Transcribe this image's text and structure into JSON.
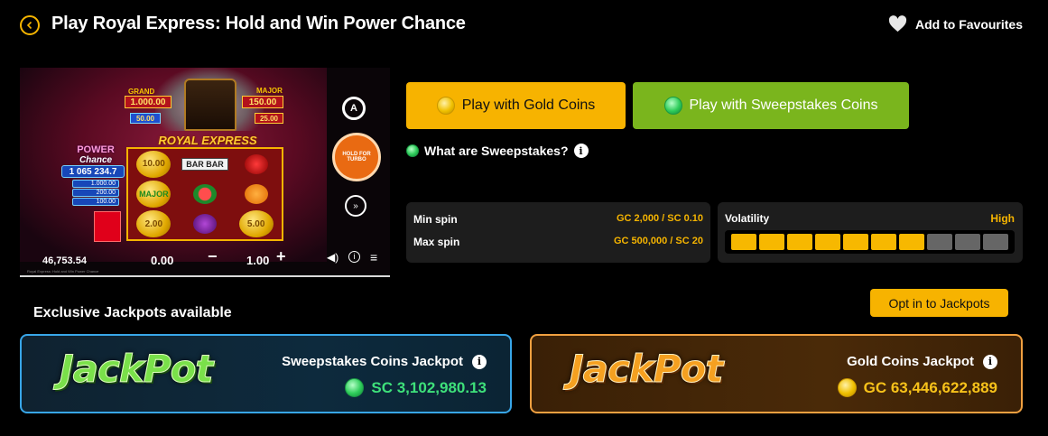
{
  "header": {
    "title": "Play Royal Express: Hold and Win Power Chance",
    "favourite_label": "Add to Favourites"
  },
  "game": {
    "grand_label": "GRAND",
    "grand_value": "1.000.00",
    "mini_value": "50.00",
    "major_label": "MAJOR",
    "major_value": "150.00",
    "minor_value": "25.00",
    "logo_text": "ROYAL EXPRESS",
    "power_text": "POWER",
    "chance_text": "Chance",
    "power_value": "1 065 234.7",
    "power_rows": [
      "1.000.00",
      "200.00",
      "100.00"
    ],
    "reels": [
      "10.00",
      "BAR BAR",
      "cherry",
      "MAJOR",
      "watermelon",
      "orange",
      "2.00",
      "grapes",
      "5.00"
    ],
    "hold_turbo_label": "HOLD FOR TURBO",
    "auto_label": "A",
    "balance": "46,753.54",
    "win": "0.00",
    "bet": "1.00",
    "minus": "−",
    "plus": "+",
    "footer_text": "Royal Express: Hold and Win Power Chance"
  },
  "actions": {
    "gold_label": "Play with Gold Coins",
    "sweep_label": "Play with Sweepstakes Coins",
    "what_label": "What are Sweepstakes?"
  },
  "spin": {
    "min_label": "Min spin",
    "min_value": "GC 2,000 / SC 0.10",
    "max_label": "Max spin",
    "max_value": "GC 500,000 / SC 20"
  },
  "volatility": {
    "label": "Volatility",
    "value": "High",
    "level": 7,
    "total": 10
  },
  "jackpots": {
    "heading": "Exclusive Jackpots available",
    "optin_label": "Opt in to Jackpots",
    "sc": {
      "logo": "JackPot",
      "title": "Sweepstakes Coins Jackpot",
      "amount": "SC 3,102,980.13"
    },
    "gc": {
      "logo": "JackPot",
      "title": "Gold Coins Jackpot",
      "amount": "GC 63,446,622,889"
    }
  },
  "colors": {
    "accent": "#f7b300",
    "sweep_green": "#7ab51d",
    "sc_border": "#38a6e8",
    "gc_border": "#f0a040"
  }
}
